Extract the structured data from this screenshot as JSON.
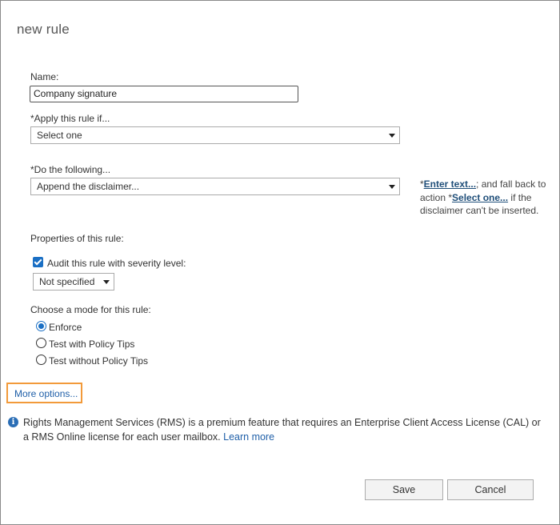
{
  "dialog": {
    "title": "new rule"
  },
  "name_field": {
    "label": "Name:",
    "value": "Company signature"
  },
  "apply_rule": {
    "label": "*Apply this rule if...",
    "selected": "Select one"
  },
  "do_following": {
    "label": "*Do the following...",
    "selected": "Append the disclaimer...",
    "note_prefix": "*",
    "note_enter_text": "Enter text...",
    "note_middle": "; and fall back to action *",
    "note_select_one": "Select one...",
    "note_suffix": " if the disclaimer can't be inserted."
  },
  "properties": {
    "label": "Properties of this rule:",
    "audit_label": "Audit this rule with severity level:",
    "audit_checked": true,
    "severity_selected": "Not specified"
  },
  "mode": {
    "label": "Choose a mode for this rule:",
    "options": [
      "Enforce",
      "Test with Policy Tips",
      "Test without Policy Tips"
    ],
    "selected_index": 0
  },
  "more_options": {
    "label": "More options..."
  },
  "info": {
    "text": "Rights Management Services (RMS) is a premium feature that requires an Enterprise Client Access License (CAL) or a RMS Online license for each user mailbox.",
    "link": "Learn more"
  },
  "buttons": {
    "save": "Save",
    "cancel": "Cancel"
  },
  "colors": {
    "accent": "#1a6fc4",
    "link": "#1f5fa8",
    "highlight_border": "#f29a3a"
  }
}
